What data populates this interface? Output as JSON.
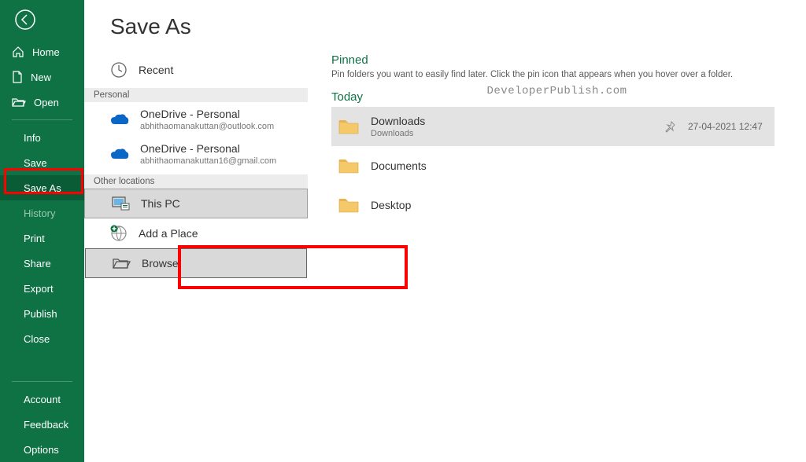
{
  "page_title": "Save As",
  "sidebar": {
    "home": "Home",
    "new": "New",
    "open": "Open",
    "info": "Info",
    "save": "Save",
    "save_as": "Save As",
    "history": "History",
    "print": "Print",
    "share": "Share",
    "export": "Export",
    "publish": "Publish",
    "close": "Close",
    "account": "Account",
    "feedback": "Feedback",
    "options": "Options"
  },
  "locations": {
    "recent": "Recent",
    "personal_header": "Personal",
    "onedrive1_title": "OneDrive - Personal",
    "onedrive1_email": "abhithaomanakuttan@outlook.com",
    "onedrive2_title": "OneDrive - Personal",
    "onedrive2_email": "abhithaomanakuttan16@gmail.com",
    "other_header": "Other locations",
    "this_pc": "This PC",
    "add_place": "Add a Place",
    "browse": "Browse"
  },
  "folders": {
    "pinned_title": "Pinned",
    "pinned_hint": "Pin folders you want to easily find later. Click the pin icon that appears when you hover over a folder.",
    "today_title": "Today",
    "downloads_name": "Downloads",
    "downloads_sub": "Downloads",
    "downloads_date": "27-04-2021 12:47",
    "documents_name": "Documents",
    "desktop_name": "Desktop"
  },
  "watermark": "DeveloperPublish.com"
}
